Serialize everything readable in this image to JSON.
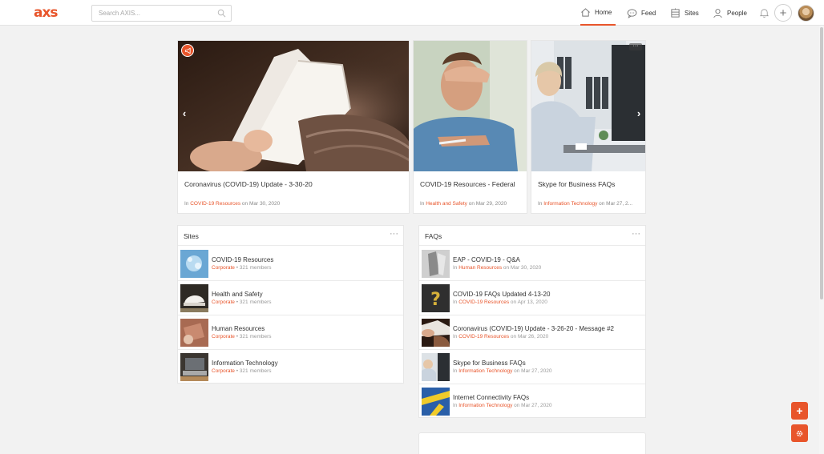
{
  "header": {
    "logo_text": "axs",
    "search_placeholder": "Search AXIS...",
    "nav": {
      "home": "Home",
      "feed": "Feed",
      "sites": "Sites",
      "people": "People"
    }
  },
  "carousel": {
    "cards": [
      {
        "title": "Coronavirus (COVID-19) Update - 3-30-20",
        "in": "In",
        "site": "COVID-19 Resources",
        "date": "on Mar 30, 2020"
      },
      {
        "title": "COVID-19 Resources - Federal",
        "in": "In",
        "site": "Health and Safety",
        "date": "on Mar 29, 2020"
      },
      {
        "title": "Skype for Business FAQs",
        "in": "In",
        "site": "Information Technology",
        "date": "on Mar 27, 2..."
      }
    ]
  },
  "sites_panel": {
    "title": "Sites",
    "items": [
      {
        "name": "COVID-19 Resources",
        "category": "Corporate",
        "members": "• 321 members"
      },
      {
        "name": "Health and Safety",
        "category": "Corporate",
        "members": "• 321 members"
      },
      {
        "name": "Human Resources",
        "category": "Corporate",
        "members": "• 321 members"
      },
      {
        "name": "Information Technology",
        "category": "Corporate",
        "members": "• 321 members"
      }
    ]
  },
  "faqs_panel": {
    "title": "FAQs",
    "items": [
      {
        "title": "EAP - COVID-19 - Q&A",
        "in": "In",
        "site": "Human Resources",
        "date": "on Mar 30, 2020"
      },
      {
        "title": "COVID-19 FAQs Updated 4-13-20",
        "in": "In",
        "site": "COVID-19 Resources",
        "date": "on Apr 13, 2020"
      },
      {
        "title": "Coronavirus (COVID-19) Update - 3-26-20 - Message #2",
        "in": "In",
        "site": "COVID-19 Resources",
        "date": "on Mar 26, 2020"
      },
      {
        "title": "Skype for Business FAQs",
        "in": "In",
        "site": "Information Technology",
        "date": "on Mar 27, 2020"
      },
      {
        "title": "Internet Connectivity FAQs",
        "in": "In",
        "site": "Information Technology",
        "date": "on Mar 27, 2020"
      }
    ]
  },
  "colors": {
    "accent": "#e8552b",
    "background": "#f2f2f2"
  },
  "icons": [
    "search-icon",
    "home-icon",
    "chat-icon",
    "sites-icon",
    "person-icon",
    "bell-icon",
    "plus-icon",
    "gear-icon",
    "megaphone-icon",
    "more-icon",
    "chevron-left-icon",
    "chevron-right-icon"
  ]
}
